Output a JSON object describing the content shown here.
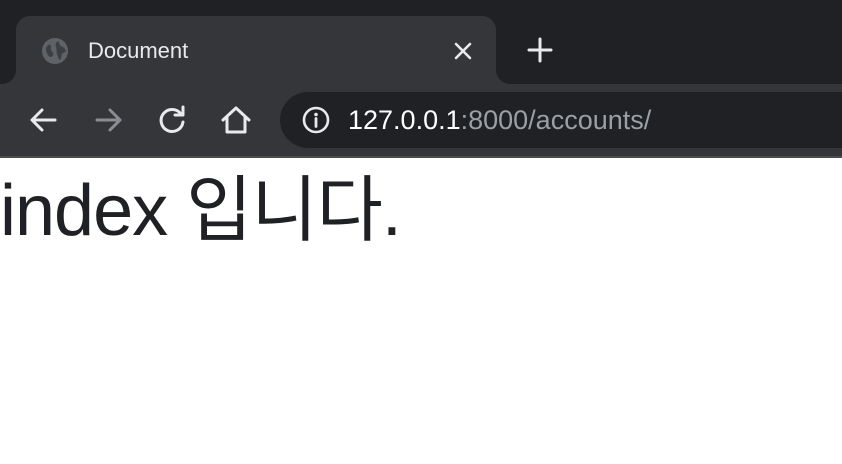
{
  "tab": {
    "title": "Document",
    "favicon": "globe-icon"
  },
  "toolbar": {
    "back_icon": "arrow-left-icon",
    "forward_icon": "arrow-right-icon",
    "reload_icon": "reload-icon",
    "home_icon": "home-icon"
  },
  "address_bar": {
    "host": "127.0.0.1",
    "rest": ":8000/accounts/",
    "security_icon": "info-icon"
  },
  "page": {
    "heading": "index 입니다."
  },
  "colors": {
    "tab_strip_bg": "#202124",
    "toolbar_bg": "#35363a",
    "omnibox_bg": "#202124",
    "text_primary": "#e8eaed",
    "text_muted": "#9aa0a6",
    "page_text": "#202124"
  }
}
